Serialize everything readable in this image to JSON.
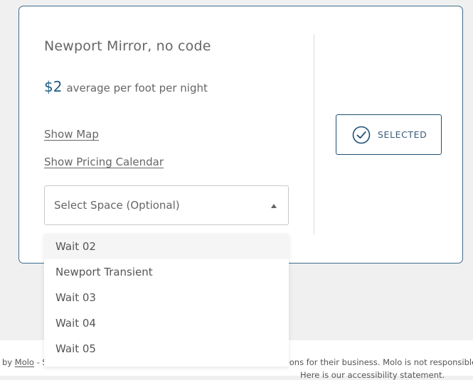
{
  "listing": {
    "title": "Newport Mirror, no code",
    "price": "$2",
    "price_suffix": "average per foot per night",
    "show_map": "Show Map",
    "show_pricing_calendar": "Show Pricing Calendar",
    "selected_label": "SELECTED"
  },
  "space_select": {
    "placeholder": "Select Space (Optional)",
    "options": [
      "Wait 02",
      "Newport Transient",
      "Wait 03",
      "Wait 04",
      "Wait 05"
    ],
    "highlighted_option": "Wait 02"
  },
  "footer": {
    "prefix": "by ",
    "brand_link": "Molo",
    "dash_fragment": " - S",
    "tail_fragment": "ations for their business. Molo is not responsible",
    "second_line_fragment": "Here is our accessibility statement."
  },
  "colors": {
    "accent": "#1d5a86",
    "card_border": "#3d6b8d",
    "page_bg": "#f0f0f0"
  },
  "icons": {
    "selected": "check-circle-icon",
    "select_arrow": "caret-up-icon"
  }
}
